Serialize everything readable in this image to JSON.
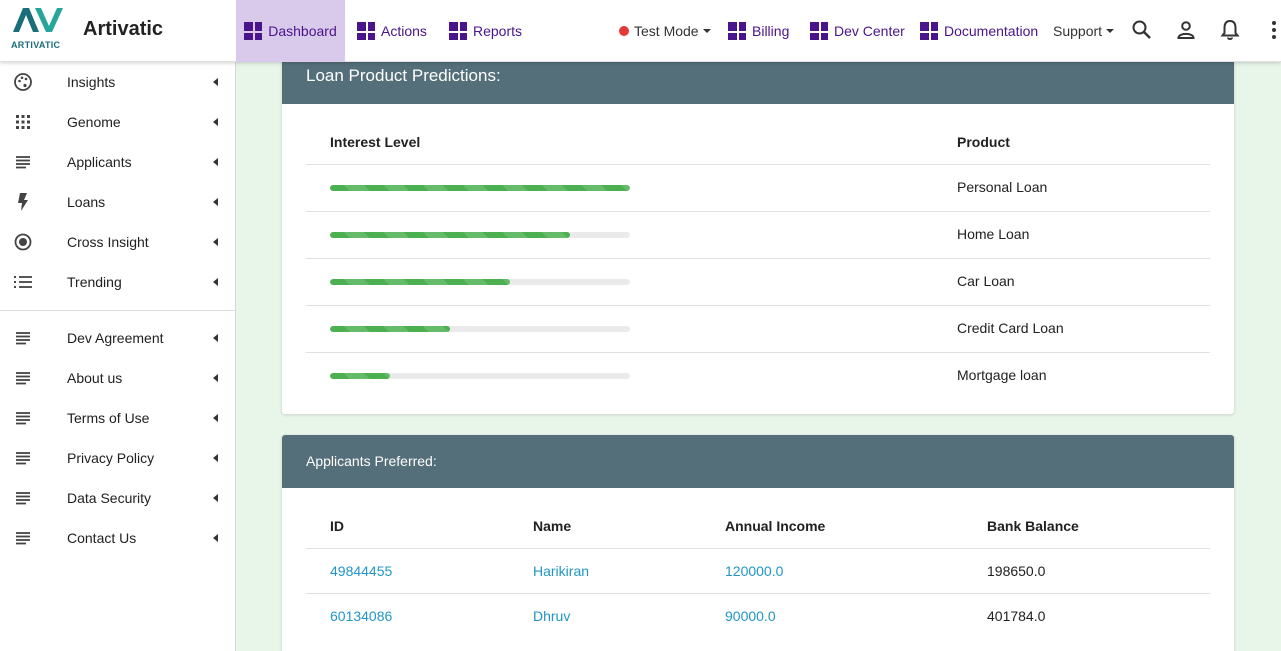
{
  "brand": {
    "logo_text": "ARTIVATIC",
    "name": "Artivatic"
  },
  "topnav": {
    "left": [
      {
        "label": "Dashboard",
        "active": true
      },
      {
        "label": "Actions"
      },
      {
        "label": "Reports"
      }
    ],
    "test_mode": "Test Mode",
    "right": [
      {
        "label": "Billing"
      },
      {
        "label": "Dev Center"
      },
      {
        "label": "Documentation"
      }
    ],
    "support": "Support"
  },
  "sidebar": {
    "items": [
      {
        "label": "Insights",
        "icon": "palette-icon"
      },
      {
        "label": "Genome",
        "icon": "apps-grid-icon"
      },
      {
        "label": "Applicants",
        "icon": "lines-icon"
      },
      {
        "label": "Loans",
        "icon": "bolt-icon"
      },
      {
        "label": "Cross Insight",
        "icon": "radio-target-icon"
      },
      {
        "label": "Trending",
        "icon": "list-icon"
      }
    ],
    "info_items": [
      {
        "label": "Dev Agreement"
      },
      {
        "label": "About us"
      },
      {
        "label": "Terms of Use"
      },
      {
        "label": "Privacy Policy"
      },
      {
        "label": "Data Security"
      },
      {
        "label": "Contact Us"
      }
    ]
  },
  "predictions": {
    "title": "Loan Product Predictions:",
    "columns": [
      "Interest Level",
      "Product"
    ],
    "rows": [
      {
        "product": "Personal Loan",
        "level": 1.0
      },
      {
        "product": "Home Loan",
        "level": 0.8
      },
      {
        "product": "Car Loan",
        "level": 0.6
      },
      {
        "product": "Credit Card Loan",
        "level": 0.4
      },
      {
        "product": "Mortgage loan",
        "level": 0.2
      }
    ]
  },
  "applicants": {
    "title": "Applicants Preferred:",
    "columns": [
      "ID",
      "Name",
      "Annual Income",
      "Bank Balance"
    ],
    "rows": [
      {
        "id": "49844455",
        "name": "Harikiran",
        "income": "120000.0",
        "balance": "198650.0"
      },
      {
        "id": "60134086",
        "name": "Dhruv",
        "income": "90000.0",
        "balance": "401784.0"
      }
    ]
  },
  "colors": {
    "accent": "#4a148c",
    "header": "#546e7a",
    "link": "#2196c7",
    "bar": "#4caf50",
    "background": "#e8f5e9"
  }
}
